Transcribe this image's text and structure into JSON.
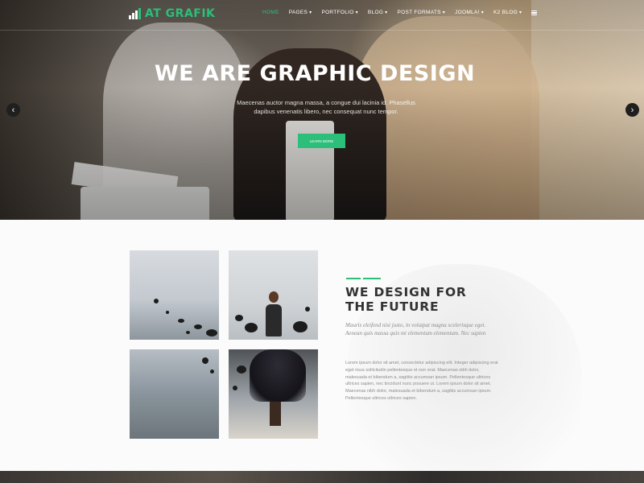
{
  "brand": {
    "name": "AT GRAFIK",
    "accent_color": "#2bbf79"
  },
  "nav": {
    "items": [
      {
        "label": "HOME",
        "active": true,
        "dropdown": false
      },
      {
        "label": "PAGES",
        "active": false,
        "dropdown": true
      },
      {
        "label": "PORTFOLIO",
        "active": false,
        "dropdown": true
      },
      {
        "label": "BLOG",
        "active": false,
        "dropdown": true
      },
      {
        "label": "POST FORMATS",
        "active": false,
        "dropdown": true
      },
      {
        "label": "JOOMLA!",
        "active": false,
        "dropdown": true
      },
      {
        "label": "K2 BLOG",
        "active": false,
        "dropdown": true
      }
    ],
    "menu_icon": "hamburger-icon"
  },
  "hero": {
    "title": "WE ARE GRAPHIC DESIGN",
    "text": "Maecenas auctor magna massa, a congue dui lacinia id. Phasellus dapibus venenatis libero, nec consequat nunc tempor.",
    "button": "LEARN MORE",
    "prev_icon": "chevron-left-icon",
    "next_icon": "chevron-right-icon"
  },
  "about": {
    "title_line1": "WE DESIGN FOR",
    "title_line2": "THE FUTURE",
    "lead": "Mauris eleifend nisi justo, in volutpat magna scelerisque eget. Aenean quis massa quis mi elementum elementum. Nec sapien",
    "body": "Lorem ipsum dolor sit amet, consectetur adipiscing elit. Integer adipiscing erat eget risus sollicitudin pellentesque et non erat. Maecenas nibh dolor, malesuada et bibendum a, sagittis accumsan ipsum. Pellentesque ultrices ultrices sapien, nec tincidunt nunc posuere ut. Lorem ipsum dolor sit amet. Maecenas nibh dolor, malesuada et bibendum a, sagittis accumsan ipsum. Pellentesque ultrices ultrices sapien."
  }
}
